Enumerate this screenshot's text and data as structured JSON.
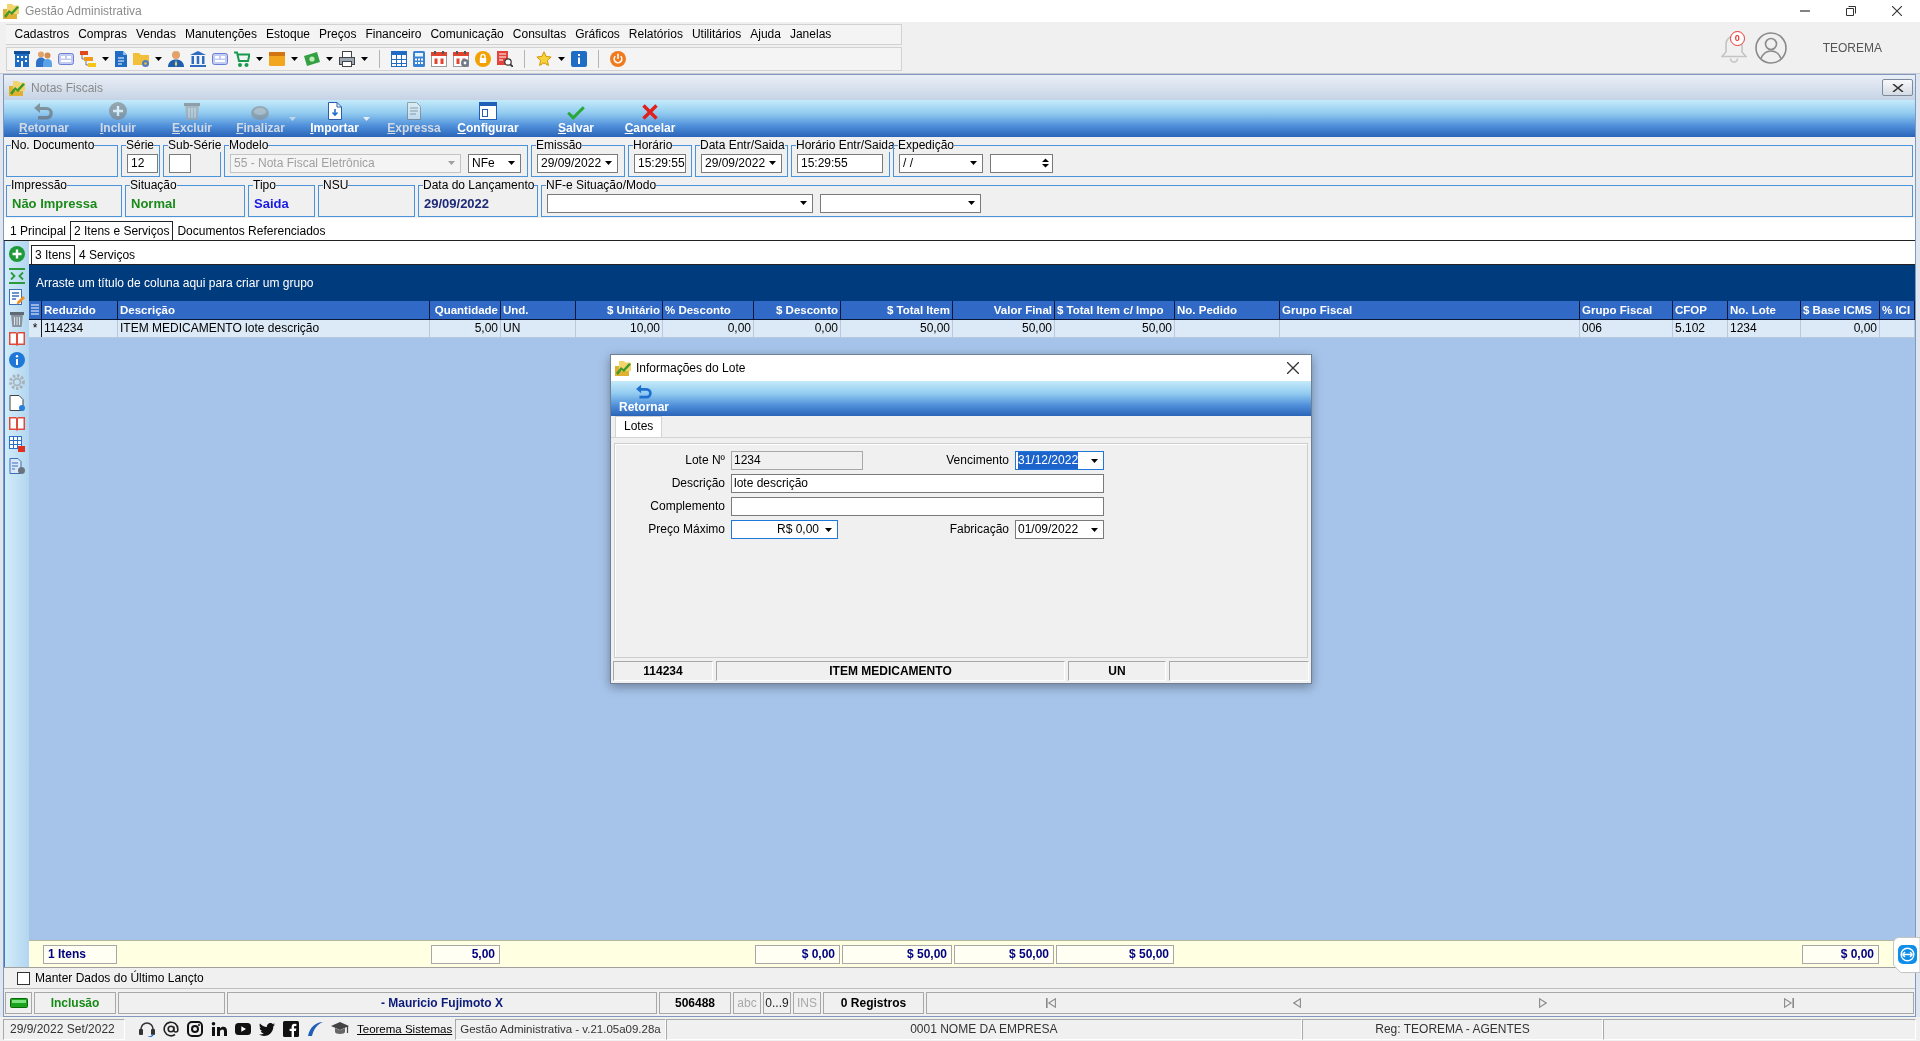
{
  "window": {
    "title": "Gestão Administrativa",
    "notifications": "0",
    "user": "TEOREMA"
  },
  "menu": [
    "Cadastros",
    "Compras",
    "Vendas",
    "Manutenções",
    "Estoque",
    "Preços",
    "Financeiro",
    "Comunicação",
    "Consultas",
    "Gráficos",
    "Relatórios",
    "Utilitários",
    "Ajuda",
    "Janelas"
  ],
  "document_window": {
    "title": "Notas Fiscais",
    "actions": [
      {
        "label": "Retornar",
        "disabled": true,
        "dropdown": false
      },
      {
        "label": "Incluir",
        "disabled": true,
        "dropdown": false
      },
      {
        "label": "Excluir",
        "disabled": true,
        "dropdown": false
      },
      {
        "label": "Finalizar",
        "disabled": true,
        "dropdown": true
      },
      {
        "label": "Importar",
        "disabled": false,
        "dropdown": true
      },
      {
        "label": "Expressa",
        "disabled": true,
        "dropdown": false
      },
      {
        "label": "Configurar",
        "disabled": false,
        "dropdown": false
      },
      {
        "label": "Salvar",
        "disabled": false,
        "dropdown": false
      },
      {
        "label": "Cancelar",
        "disabled": false,
        "dropdown": false
      }
    ],
    "header_rows": [
      [
        {
          "label": "No. Documento",
          "kind": "display"
        },
        {
          "label": "Série",
          "kind": "controls",
          "controls": [
            {
              "kind": "input",
              "value": "12"
            }
          ]
        },
        {
          "label": "Sub-Série",
          "kind": "controls",
          "controls": [
            {
              "kind": "input"
            }
          ]
        },
        {
          "label": "Modelo",
          "kind": "controls",
          "controls": [
            {
              "kind": "select",
              "value": "55 - Nota Fiscal Eletrônica",
              "disabled": true
            },
            {
              "kind": "select",
              "value": "NFe",
              "disabled": false
            }
          ]
        },
        {
          "label": "Emissão",
          "kind": "controls",
          "controls": [
            {
              "kind": "select",
              "value": "29/09/2022",
              "disabled": false
            }
          ]
        },
        {
          "label": "Horário",
          "kind": "controls",
          "controls": [
            {
              "kind": "input",
              "value": "15:29:55"
            }
          ]
        },
        {
          "label": "Data Entr/Saida",
          "kind": "controls",
          "controls": [
            {
              "kind": "select",
              "value": "29/09/2022",
              "disabled": false
            }
          ]
        },
        {
          "label": "Horário Entr/Saida",
          "kind": "controls",
          "controls": [
            {
              "kind": "input",
              "value": "15:29:55"
            }
          ]
        },
        {
          "label": "Expedição",
          "kind": "controls",
          "controls": [
            {
              "kind": "select",
              "value": "/ /",
              "disabled": false
            },
            {
              "kind": "spin"
            }
          ]
        }
      ],
      [
        {
          "label": "Impressão",
          "kind": "display",
          "value": "Não Impressa",
          "color": "#1a8a1a"
        },
        {
          "label": "Situação",
          "kind": "display",
          "value": "Normal",
          "color": "#1a8a1a"
        },
        {
          "label": "Tipo",
          "kind": "display",
          "value": "Saida",
          "color": "#1a1ae6"
        },
        {
          "label": "NSU",
          "kind": "display"
        },
        {
          "label": "Data do Lançamento",
          "kind": "display",
          "value": "29/09/2022",
          "color": "#1c2a78"
        },
        {
          "label": "NF-e Situação/Modo",
          "kind": "controls",
          "controls": [
            {
              "kind": "select",
              "disabled": false
            },
            {
              "kind": "select",
              "disabled": false
            }
          ]
        }
      ]
    ],
    "tabs": [
      {
        "label": "1 Principal",
        "selected": false
      },
      {
        "label": "2 Itens e Serviços",
        "selected": true
      },
      {
        "label": "Documentos Referenciados",
        "selected": false
      }
    ],
    "subtabs": [
      {
        "label": "3 Itens",
        "selected": true
      },
      {
        "label": "4 Serviços",
        "selected": false
      }
    ],
    "grid": {
      "group_hint": "Arraste um título de coluna aqui para criar um grupo",
      "columns": [
        {
          "label": "Reduzido",
          "total": "1 Itens"
        },
        {
          "label": "Descrição"
        },
        {
          "label": "Quantidade",
          "total": "5,00"
        },
        {
          "label": "Und."
        },
        {
          "label": "$ Unitário"
        },
        {
          "label": "% Desconto"
        },
        {
          "label": "$ Desconto",
          "total": "$ 0,00"
        },
        {
          "label": "$ Total Item",
          "total": "$ 50,00"
        },
        {
          "label": "Valor Final",
          "total": "$ 50,00"
        },
        {
          "label": "$ Total Item c/ Impo",
          "total": "$ 50,00"
        },
        {
          "label": "No. Pedido"
        },
        {
          "label": "Grupo Fiscal"
        },
        {
          "label": "Grupo Fiscal"
        },
        {
          "label": "CFOP"
        },
        {
          "label": "No. Lote"
        },
        {
          "label": "$ Base ICMS",
          "total": "$ 0,00"
        },
        {
          "label": "% ICI"
        }
      ],
      "rows": [
        {
          "marker": "*",
          "cells": [
            "114234",
            "ITEM MEDICAMENTO lote descrição",
            "5,00",
            "UN",
            "10,00",
            "0,00",
            "0,00",
            "50,00",
            "50,00",
            "50,00",
            null,
            null,
            "006",
            "5.102",
            "1234",
            "0,00",
            null
          ]
        }
      ]
    },
    "keep_last_entry": {
      "label": "Manter Dados do Último Lançto",
      "checked": false
    },
    "status_bar": {
      "mode": "Inclusão",
      "user": "- Mauricio Fujimoto X",
      "code": "506488",
      "indicators": [
        {
          "label": "abc",
          "on": false
        },
        {
          "label": "0...9",
          "on": true
        },
        {
          "label": "INS",
          "on": false
        }
      ],
      "records": "0 Registros"
    }
  },
  "dialog": {
    "title": "Informações do Lote",
    "actions": [
      {
        "label": "Retornar"
      }
    ],
    "tabs": [
      {
        "label": "Lotes",
        "selected": true
      }
    ],
    "rows": [
      [
        {
          "label": "Lote Nº",
          "kind": "readonly",
          "value": "1234"
        },
        {
          "label": "Vencimento",
          "kind": "date",
          "value": "31/12/2022",
          "highlighted": true
        }
      ],
      [
        {
          "label": "Descrição",
          "kind": "text",
          "value": "lote descrição"
        }
      ],
      [
        {
          "label": "Complemento",
          "kind": "text"
        }
      ],
      [
        {
          "label": "Preço Máximo",
          "kind": "currency",
          "value": "R$ 0,00"
        },
        {
          "label": "Fabricação",
          "kind": "date",
          "value": "01/09/2022",
          "highlighted": false
        }
      ]
    ],
    "footer": [
      "114234",
      "ITEM MEDICAMENTO",
      "UN"
    ]
  },
  "footer": {
    "date": "29/9/2022 Set/2022",
    "link": "Teorema Sistemas",
    "version": "Gestão Administrativa - v.21.05a09.28a",
    "company": "0001 NOME DA EMPRESA",
    "registration": "Reg: TEOREMA - AGENTES"
  }
}
